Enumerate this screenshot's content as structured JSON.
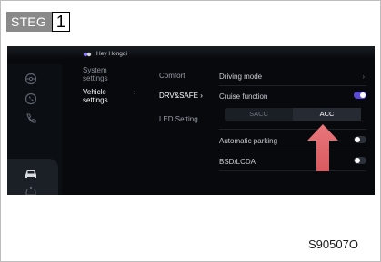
{
  "step": {
    "label": "STEG",
    "number": "1"
  },
  "screen": {
    "greeting": "Hey Hongqi",
    "menu_primary": [
      {
        "label": "System\nsettings",
        "active": false
      },
      {
        "label": "Vehicle\nsettings",
        "active": true
      }
    ],
    "menu_secondary": [
      {
        "label": "Comfort",
        "active": false
      },
      {
        "label": "DRV&SAFE",
        "active": true
      },
      {
        "label": "LED Setting",
        "active": false
      }
    ],
    "settings": {
      "driving_mode": "Driving mode",
      "cruise_function": "Cruise function",
      "cruise_options": [
        "SACC",
        "ACC"
      ],
      "cruise_selected": "ACC",
      "automatic_parking": "Automatic parking",
      "bsd_lcda": "BSD/LCDA"
    },
    "toggles": {
      "cruise_function": true,
      "automatic_parking": false,
      "bsd_lcda": false
    },
    "rail_icons": [
      "steering-wheel-icon",
      "phone-ring-icon",
      "phone-icon",
      "car-icon",
      "car-settings-icon"
    ],
    "accent_color": "#5a4bd6",
    "arrow_color": "#e0676c"
  },
  "figure_code": "S90507O"
}
